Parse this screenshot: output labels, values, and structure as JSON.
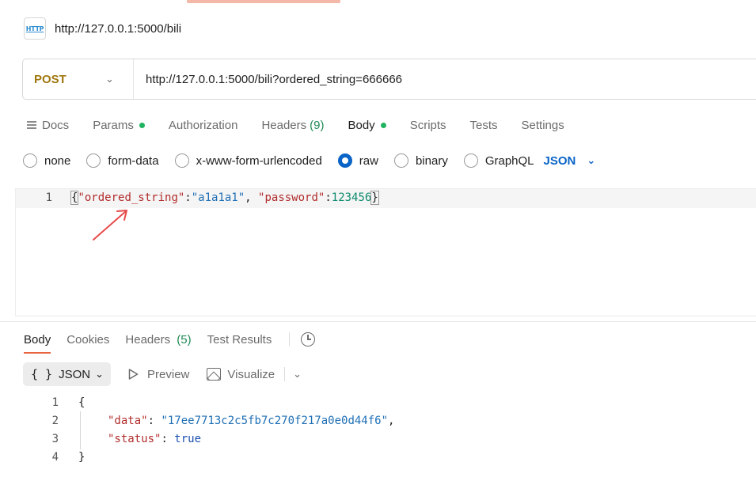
{
  "request": {
    "title": "http://127.0.0.1:5000/bili",
    "badge_text": "HTTP",
    "method": "POST",
    "url": "http://127.0.0.1:5000/bili?ordered_string=666666"
  },
  "request_tabs": {
    "docs": "Docs",
    "params": "Params",
    "authorization": "Authorization",
    "headers": "Headers",
    "headers_count": "(9)",
    "body": "Body",
    "scripts": "Scripts",
    "tests": "Tests",
    "settings": "Settings"
  },
  "body_types": {
    "none": "none",
    "form_data": "form-data",
    "urlencoded": "x-www-form-urlencoded",
    "raw": "raw",
    "binary": "binary",
    "graphql": "GraphQL",
    "format": "JSON",
    "selected": "raw"
  },
  "request_body": {
    "line_number": "1",
    "open": "{",
    "key1": "\"ordered_string\"",
    "colon1": ":",
    "val1": "\"a1a1a1\"",
    "sep": ", ",
    "key2": "\"password\"",
    "colon2": ":",
    "val2": "123456",
    "close": "}"
  },
  "response_tabs": {
    "body": "Body",
    "cookies": "Cookies",
    "headers": "Headers",
    "headers_count": "(5)",
    "test_results": "Test Results"
  },
  "response_toolbar": {
    "format": "JSON",
    "preview": "Preview",
    "visualize": "Visualize"
  },
  "response_body": {
    "lines": [
      {
        "num": "1",
        "text": "{"
      },
      {
        "num": "2",
        "key": "\"data\"",
        "colon": ": ",
        "value": "\"17ee7713c2c5fb7c270f217a0e0d44f6\"",
        "tail": ","
      },
      {
        "num": "3",
        "key": "\"status\"",
        "colon": ": ",
        "value": "true"
      },
      {
        "num": "4",
        "text": "}"
      }
    ]
  },
  "colors": {
    "method": "#a0770e",
    "accent": "#e8663f",
    "link_blue": "#0a64c7",
    "status_green": "#21b35f",
    "json_key": "#b22c2c",
    "json_string": "#1f6fb5",
    "json_number": "#0e8a6e",
    "annotation_arrow": "#e84a4a"
  },
  "icons": [
    "http-badge-icon",
    "docs-icon",
    "chevron-down-icon",
    "history-icon",
    "play-icon",
    "image-icon"
  ]
}
